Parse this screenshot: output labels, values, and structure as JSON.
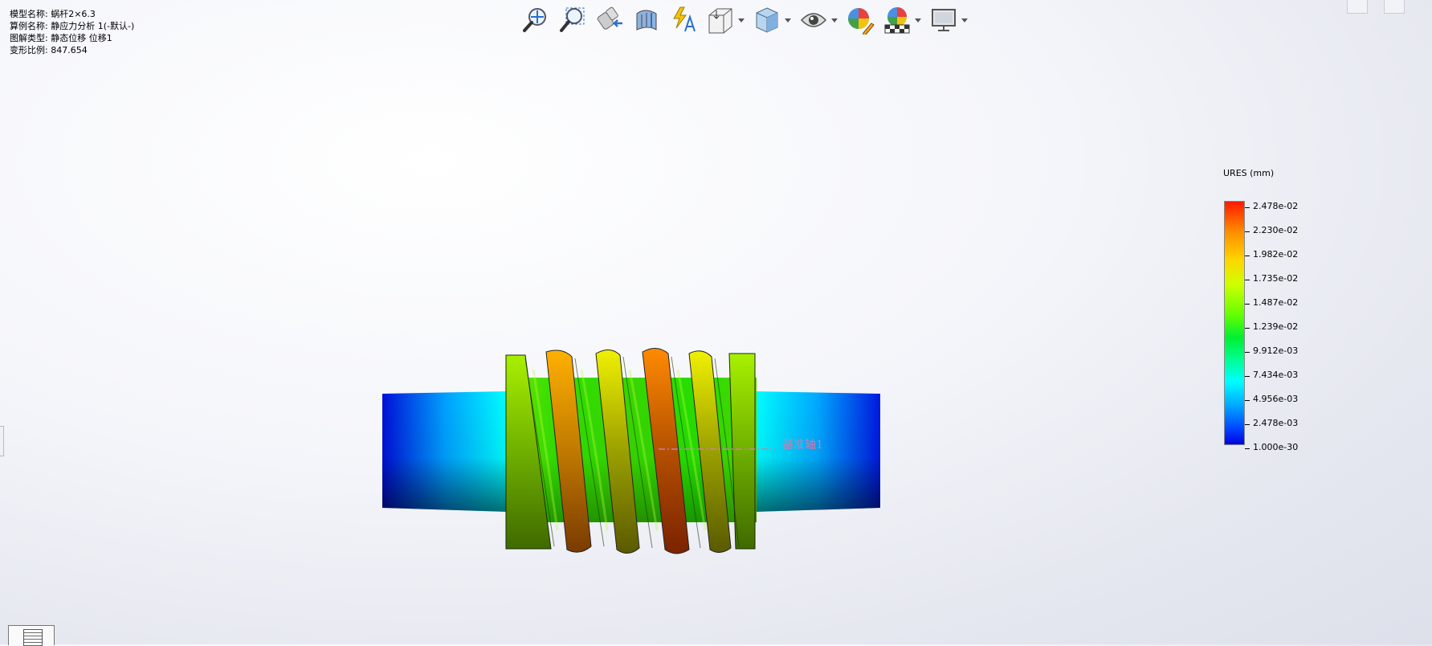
{
  "info": {
    "model_label": "模型名称:",
    "model_value": "蜗杆2×6.3",
    "study_label": "算例名称:",
    "study_value": "静应力分析 1(-默认-)",
    "plot_type_label": "图解类型:",
    "plot_type_value": "静态位移 位移1",
    "deformation_label": "变形比例:",
    "deformation_value": "847.654"
  },
  "toolbar": {
    "buttons": [
      {
        "name": "zoom-to-fit-icon"
      },
      {
        "name": "zoom-to-area-icon"
      },
      {
        "name": "previous-view-icon"
      },
      {
        "name": "section-view-icon"
      },
      {
        "name": "dynamic-annotation-icon"
      },
      {
        "name": "view-orientation-icon",
        "dropdown": true
      },
      {
        "name": "display-style-icon",
        "dropdown": true
      },
      {
        "name": "hide-show-items-icon",
        "dropdown": true
      },
      {
        "name": "edit-appearance-icon"
      },
      {
        "name": "apply-scene-icon",
        "dropdown": true
      },
      {
        "name": "view-settings-icon",
        "dropdown": true
      }
    ]
  },
  "legend": {
    "title": "URES (mm)",
    "labels": [
      "2.478e-02",
      "2.230e-02",
      "1.982e-02",
      "1.735e-02",
      "1.487e-02",
      "1.239e-02",
      "9.912e-03",
      "7.434e-03",
      "4.956e-03",
      "2.478e-03",
      "1.000e-30"
    ],
    "colors": {
      "max": "#ff1a00",
      "mid": "#00f030",
      "min": "#0000e0"
    }
  },
  "model": {
    "axis_label": "基准轴1"
  }
}
